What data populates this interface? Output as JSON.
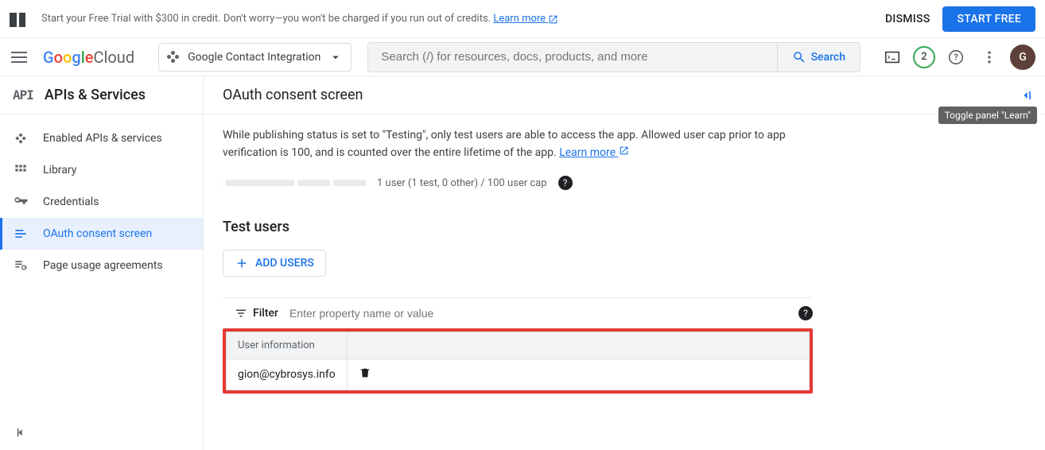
{
  "banner": {
    "text_prefix": "Start your Free Trial with $300 in credit. Don't worry—you won't be charged if you run out of credits. ",
    "learn_more": "Learn more",
    "dismiss": "DISMISS",
    "start_free": "START FREE"
  },
  "header": {
    "logo_prefix": "Google",
    "logo_suffix": " Cloud",
    "project_name": "Google Contact Integration",
    "search_placeholder": "Search (/) for resources, docs, products, and more",
    "search_label": "Search",
    "badge_count": "2",
    "avatar_initial": "G"
  },
  "sidebar": {
    "api_icon_text": "API",
    "title": "APIs & Services",
    "items": [
      {
        "label": "Enabled APIs & services",
        "icon": "diamond",
        "active": false
      },
      {
        "label": "Library",
        "icon": "grid",
        "active": false
      },
      {
        "label": "Credentials",
        "icon": "key",
        "active": false
      },
      {
        "label": "OAuth consent screen",
        "icon": "consent",
        "active": true
      },
      {
        "label": "Page usage agreements",
        "icon": "agree",
        "active": false
      }
    ]
  },
  "main": {
    "title": "OAuth consent screen",
    "description": "While publishing status is set to \"Testing\", only test users are able to access the app. Allowed user cap prior to app verification is 100, and is counted over the entire lifetime of the app. ",
    "learn_more": "Learn more",
    "cap_text": "1 user (1 test, 0 other) / 100 user cap",
    "section_title": "Test users",
    "add_users": "ADD USERS",
    "filter_label": "Filter",
    "filter_placeholder": "Enter property name or value",
    "table": {
      "header": "User information",
      "rows": [
        {
          "email": "gion@cybrosys.info"
        }
      ]
    }
  },
  "tooltip": "Toggle panel \"Learn\""
}
